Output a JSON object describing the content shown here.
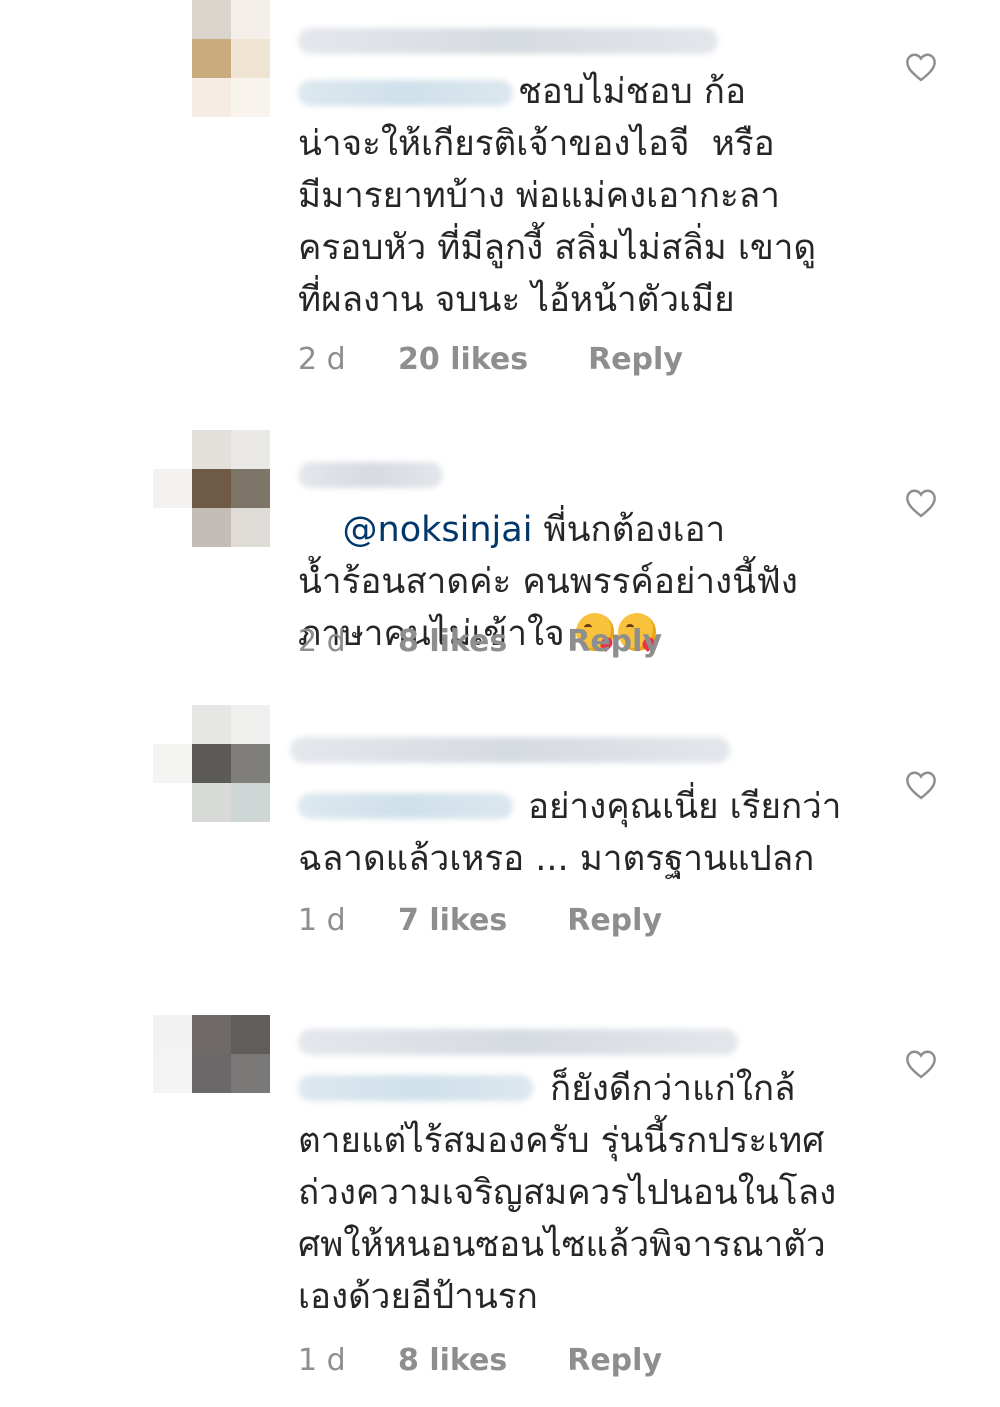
{
  "colors": {
    "text": "#262626",
    "meta": "#8e8e8e",
    "mention": "#00376b",
    "heart_outline": "#8e8e8e"
  },
  "comments": [
    {
      "text_after_mention": "ชอบไม่ชอบ ก้อ\nน่าจะให้เกียรติเจ้าของไอจี  หรือ\nมีมารยาทบ้าง พ่อแม่คงเอากะลา\nครอบหัว ที่มีลูกงี้ สลิ่มไม่สลิ่ม เขาดู\nที่ผลงาน จบนะ ไอ้หน้าตัวเมีย",
      "age": "2 d",
      "likes": "20 likes",
      "reply_label": "Reply",
      "like_icon": "heart-outline-icon"
    },
    {
      "mention": "@noksinjai",
      "text_after_mention": " พี่นกต้องเอา\nน้ำร้อนสาดค่ะ คนพรรค์อย่างนี้ฟัง\nภาษาคนไม่เข้าใจ ",
      "emojis": [
        "kissing-face-with-heart-emoji",
        "kissing-face-with-heart-emoji"
      ],
      "age": "2 d",
      "likes": "8 likes",
      "reply_label": "Reply",
      "like_icon": "heart-outline-icon"
    },
    {
      "text_after_mention": "อย่างคุณเนี่ย เรียกว่า\nฉลาดแล้วเหรอ ... มาตรฐานแปลก",
      "age": "1 d",
      "likes": "7 likes",
      "reply_label": "Reply",
      "like_icon": "heart-outline-icon"
    },
    {
      "text_after_mention": "ก็ยังดีกว่าแก่ใกล้\nตายแต่ไร้สมองครับ รุ่นนี้รกประเทศ\nถ่วงความเจริญสมควรไปนอนในโลง\nศพให้หนอนซอนไซแล้วพิจารณาตัว\nเองด้วยอีป้านรก",
      "age": "1 d",
      "likes": "8 likes",
      "reply_label": "Reply",
      "like_icon": "heart-outline-icon"
    }
  ]
}
